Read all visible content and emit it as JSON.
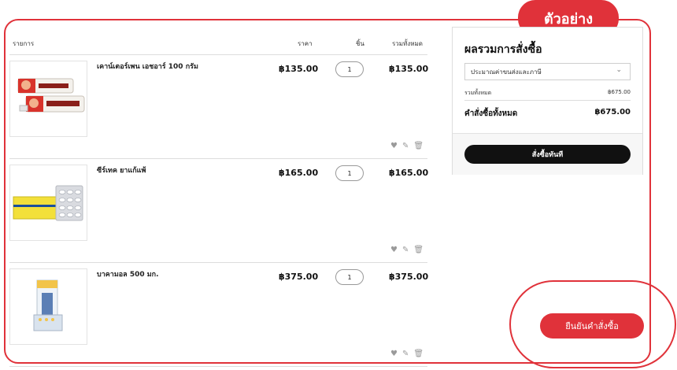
{
  "badge": {
    "label": "ตัวอย่าง"
  },
  "cart": {
    "columns": {
      "item": "รายการ",
      "price": "ราคา",
      "qty": "ชิ้น",
      "total": "รวมทั้งหมด"
    },
    "items": [
      {
        "name": "เคาน์เตอร์เพน เอชอาร์ 100 กรัม",
        "price": "฿135.00",
        "qty": "1",
        "total": "฿135.00",
        "image_text": "Counterpain"
      },
      {
        "name": "ซีร์เทค ยาแก้แพ้",
        "price": "฿165.00",
        "qty": "1",
        "total": "฿165.00",
        "image_text": "Zyrtec"
      },
      {
        "name": "บาคามอล 500 มก.",
        "price": "฿375.00",
        "qty": "1",
        "total": "฿375.00",
        "image_text": ""
      }
    ],
    "action_icons": [
      "heart-icon",
      "pencil-icon",
      "trash-icon"
    ]
  },
  "summary": {
    "title": "ผลรวมการสั่งซื้อ",
    "shipping_select": "ประมาณค่าขนส่งและภาษี",
    "subtotal_label": "รวมทั้งหมด",
    "subtotal_value": "฿675.00",
    "grand_label": "คำสั่งซื้อทั้งหมด",
    "grand_value": "฿675.00",
    "buy_now": "สั่งซื้อทันที"
  },
  "confirm": {
    "label": "ยืนยันคำสั่งซื้อ"
  },
  "colors": {
    "accent": "#e0323a",
    "dark": "#111111"
  }
}
